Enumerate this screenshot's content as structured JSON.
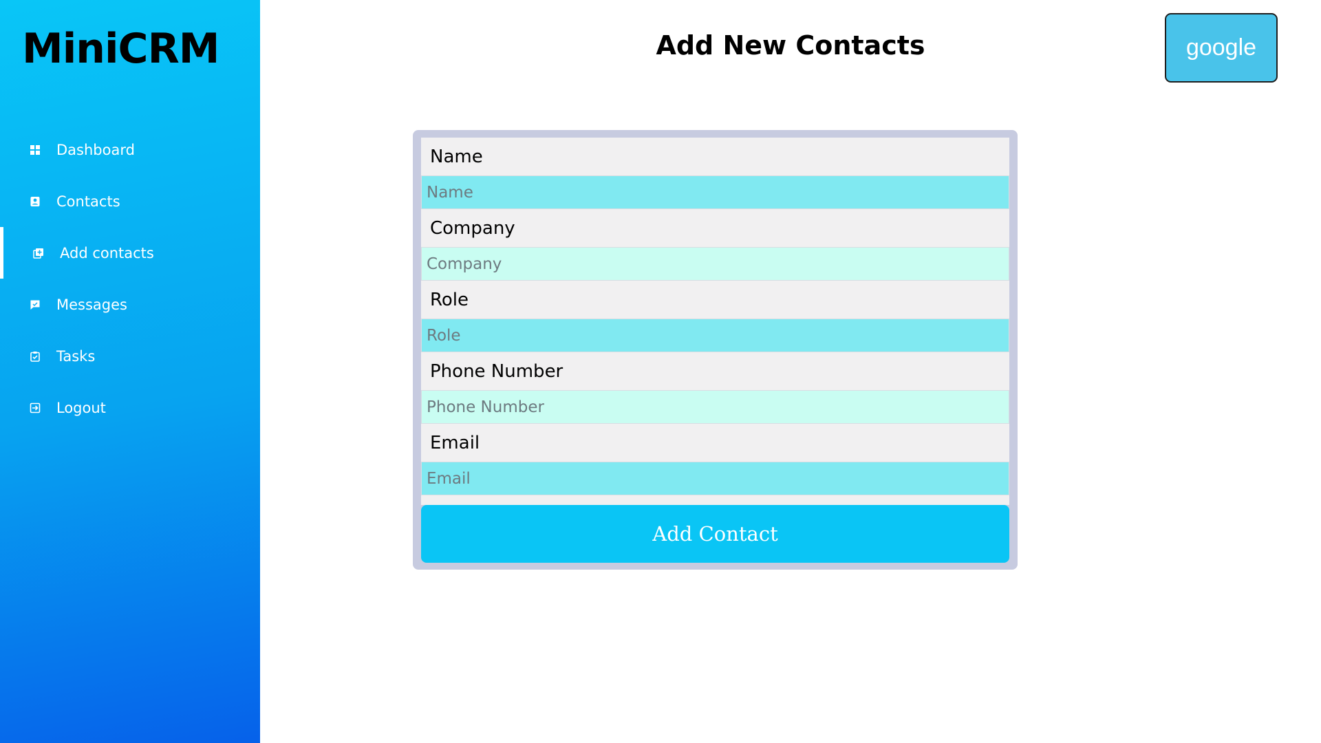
{
  "app": {
    "logo": "MiniCRM"
  },
  "sidebar": {
    "items": [
      {
        "label": "Dashboard",
        "icon": "dashboard-icon"
      },
      {
        "label": "Contacts",
        "icon": "contacts-icon"
      },
      {
        "label": "Add contacts",
        "icon": "add-contact-icon",
        "active": true
      },
      {
        "label": "Messages",
        "icon": "messages-icon"
      },
      {
        "label": "Tasks",
        "icon": "tasks-icon"
      },
      {
        "label": "Logout",
        "icon": "logout-icon"
      }
    ]
  },
  "header": {
    "title": "Add New Contacts",
    "google_label": "google"
  },
  "form": {
    "fields": [
      {
        "label": "Name",
        "placeholder": "Name",
        "value": ""
      },
      {
        "label": "Company",
        "placeholder": "Company",
        "value": ""
      },
      {
        "label": "Role",
        "placeholder": "Role",
        "value": ""
      },
      {
        "label": "Phone Number",
        "placeholder": "Phone Number",
        "value": ""
      },
      {
        "label": "Email",
        "placeholder": "Email",
        "value": ""
      }
    ],
    "submit_label": "Add Contact"
  },
  "colors": {
    "sidebar_top": "#09c6f7",
    "sidebar_bottom": "#0661ea",
    "input_cyan": "#80e9f1",
    "input_mint": "#c9fdf2",
    "button": "#0ac5f5",
    "google_button": "#49c3ea"
  }
}
